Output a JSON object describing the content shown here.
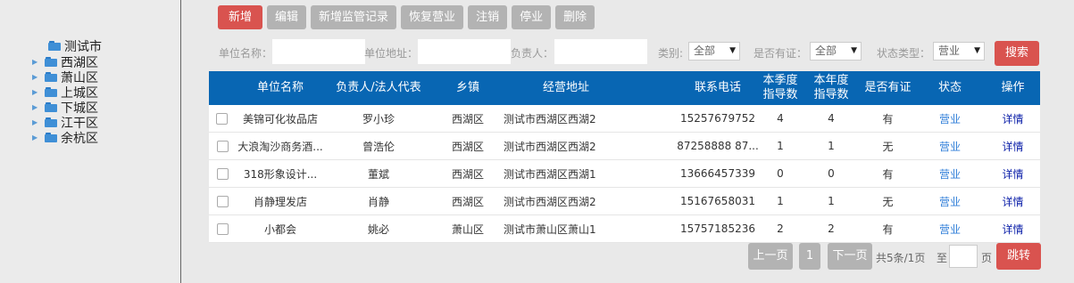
{
  "tree": {
    "root": "测试市",
    "items": [
      {
        "label": "西湖区"
      },
      {
        "label": "萧山区"
      },
      {
        "label": "上城区"
      },
      {
        "label": "下城区"
      },
      {
        "label": "江干区"
      },
      {
        "label": "余杭区"
      }
    ]
  },
  "toolbar": {
    "add": "新增",
    "edit": "编辑",
    "add_record": "新增监管记录",
    "resume": "恢复营业",
    "cancel": "注销",
    "suspend": "停业",
    "delete": "删除"
  },
  "filters": {
    "unit_name_label": "单位名称：",
    "unit_name_value": "",
    "address_label": "单位地址：",
    "address_value": "",
    "owner_label": "负责人：",
    "owner_value": "",
    "category_label": "类别:",
    "category_value": "全部",
    "certificate_label": "是否有证：",
    "certificate_value": "全部",
    "status_label": "状态类型：",
    "status_value": "营业",
    "search_button": "搜索"
  },
  "table": {
    "headers": {
      "name": "单位名称",
      "owner": "负责人/法人代表",
      "town": "乡镇",
      "address": "经营地址",
      "phone": "联系电话",
      "quarter_1": "本季度",
      "quarter_2": "指导数",
      "year_1": "本年度",
      "year_2": "指导数",
      "certified": "是否有证",
      "status": "状态",
      "action": "操作"
    },
    "rows": [
      {
        "name": "美锦可化妆品店",
        "owner": "罗小珍",
        "town": "西湖区",
        "address": "测试市西湖区西湖2",
        "phone": "15257679752",
        "quarter": "4",
        "year": "4",
        "certified": "有",
        "status": "营业",
        "action": "详情"
      },
      {
        "name": "大浪淘沙商务酒...",
        "owner": "曾浩伦",
        "town": "西湖区",
        "address": "测试市西湖区西湖2",
        "phone": "87258888 87...",
        "quarter": "1",
        "year": "1",
        "certified": "无",
        "status": "营业",
        "action": "详情"
      },
      {
        "name": "318形象设计...",
        "owner": "董斌",
        "town": "西湖区",
        "address": "测试市西湖区西湖1",
        "phone": "13666457339",
        "quarter": "0",
        "year": "0",
        "certified": "有",
        "status": "营业",
        "action": "详情"
      },
      {
        "name": "肖静理发店",
        "owner": "肖静",
        "town": "西湖区",
        "address": "测试市西湖区西湖2",
        "phone": "15167658031",
        "quarter": "1",
        "year": "1",
        "certified": "无",
        "status": "营业",
        "action": "详情"
      },
      {
        "name": "小都会",
        "owner": "姚必",
        "town": "萧山区",
        "address": "测试市萧山区萧山1",
        "phone": "15757185236",
        "quarter": "2",
        "year": "2",
        "certified": "有",
        "status": "营业",
        "action": "详情"
      }
    ]
  },
  "pager": {
    "prev": "上一页",
    "current": "1",
    "next": "下一页",
    "summary": "共5条/1页",
    "goto_prefix": "至",
    "goto_value": "",
    "goto_suffix": "页",
    "jump": "跳转"
  }
}
